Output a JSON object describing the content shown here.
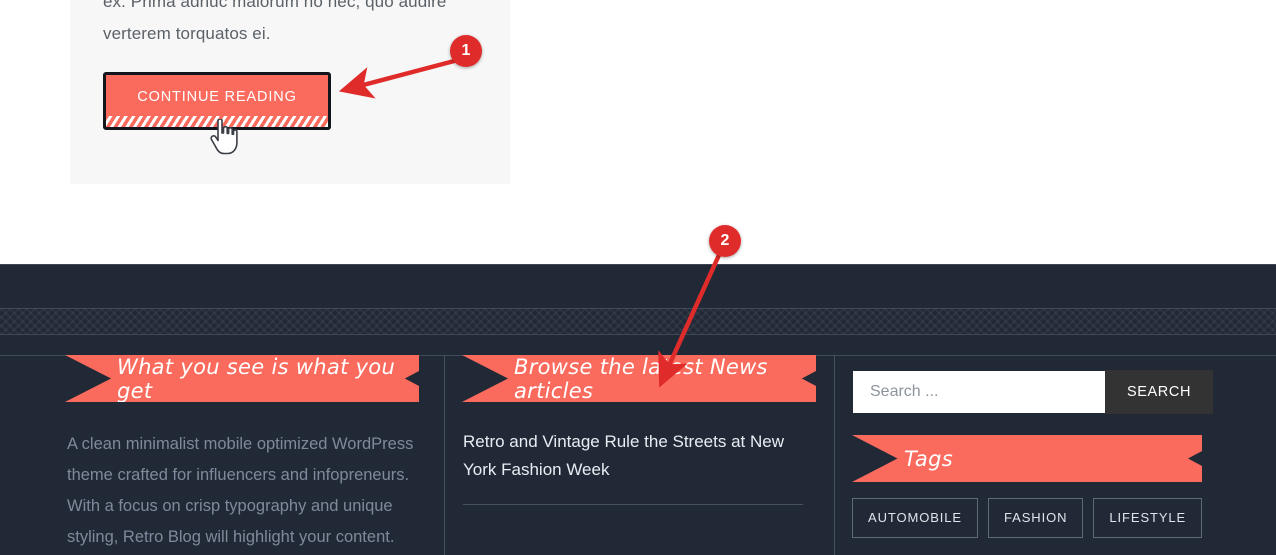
{
  "article": {
    "body_text": "ex. Prima adhuc malorum no nec, quo audire verterem torquatos ei.",
    "continue_label": "CONTINUE READING"
  },
  "cursor": {
    "icon": "pointing-hand-cursor"
  },
  "footer": {
    "about_widget": {
      "title": "What you see is what you get",
      "text": "A clean minimalist mobile optimized WordPress theme crafted for influencers and infopreneurs. With a focus on crisp typography and unique styling, Retro Blog will highlight your content."
    },
    "news_widget": {
      "title": "Browse the latest News articles",
      "posts": [
        {
          "title": "Retro and Vintage Rule the Streets at New York Fashion Week"
        }
      ]
    },
    "search_widget": {
      "placeholder": "Search ...",
      "value": "",
      "button_label": "SEARCH"
    },
    "tags_widget": {
      "title": "Tags",
      "tags": [
        "AUTOMOBILE",
        "FASHION",
        "LIFESTYLE"
      ]
    }
  },
  "annotations": [
    {
      "id": "1",
      "label": "1",
      "target": "continue-reading-button"
    },
    {
      "id": "2",
      "label": "2",
      "target": "news-widget-ribbon"
    }
  ],
  "colors": {
    "accent": "#fa6b5d",
    "footer_bg": "#222936",
    "annotation": "#e02b2b",
    "search_button": "#333333"
  }
}
